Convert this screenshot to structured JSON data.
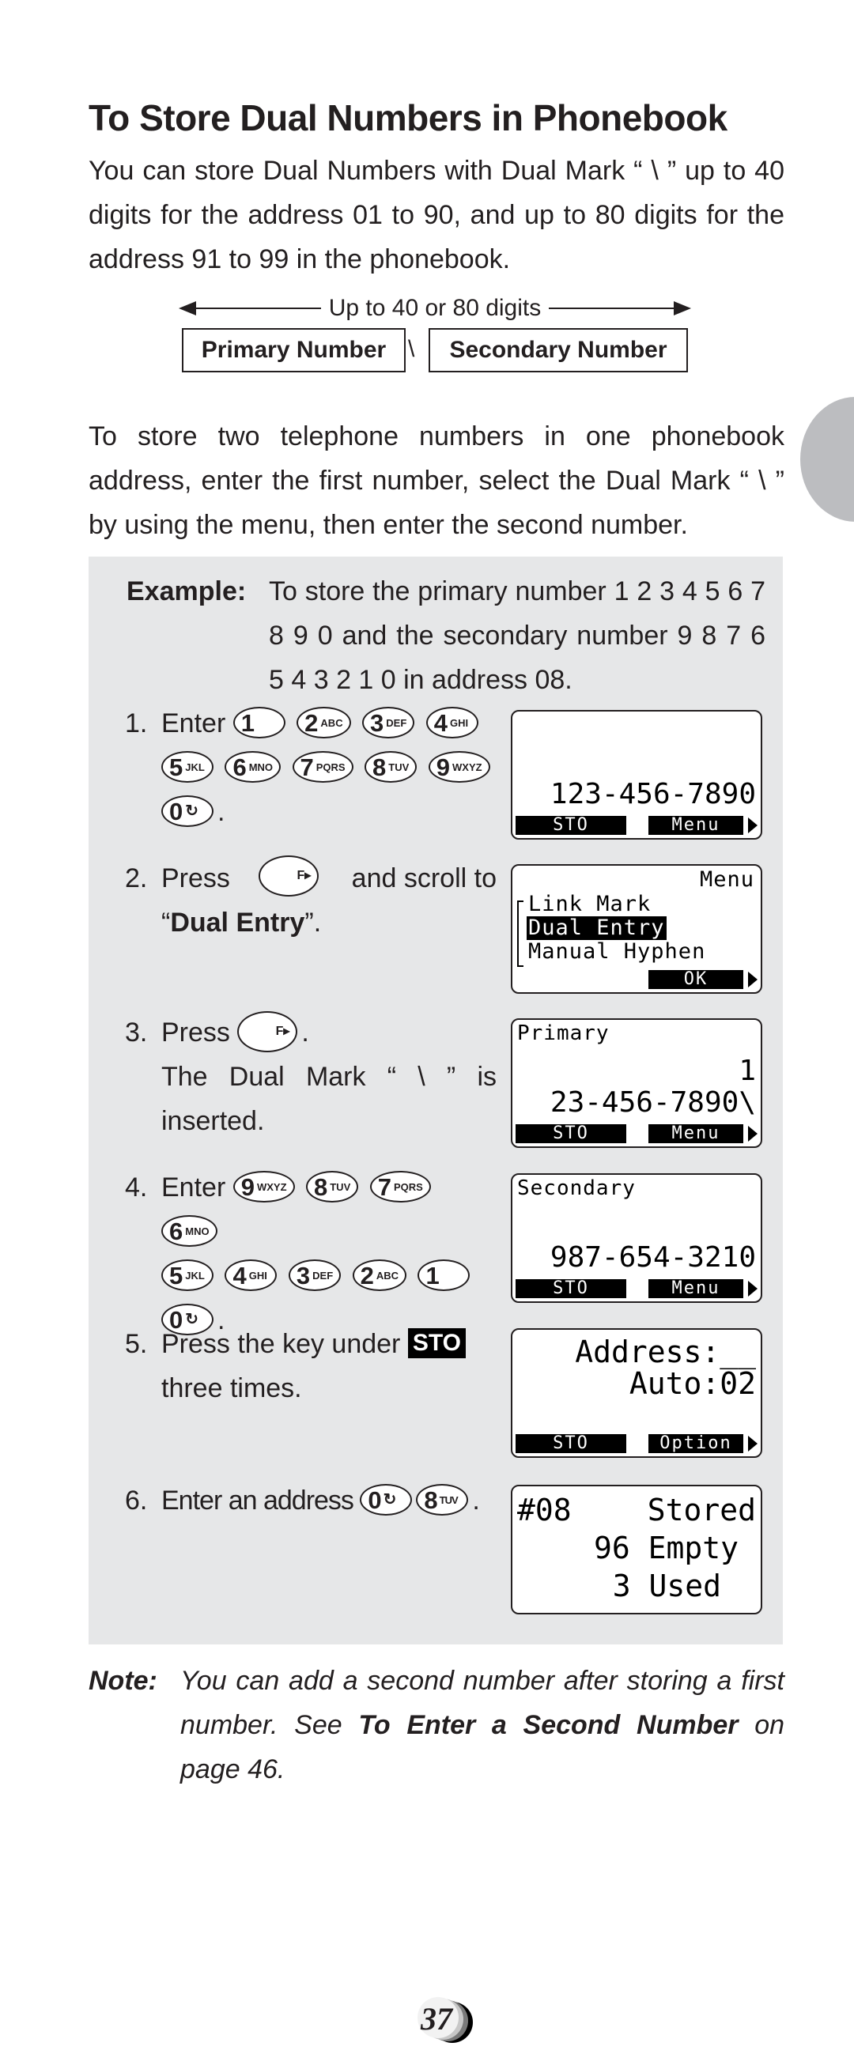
{
  "title": "To Store Dual Numbers in Phonebook",
  "intro": "You can store Dual Numbers with Dual Mark “ \\ ” up to 40 digits for the address 01 to 90, and up to 80 digits for the address 91 to 99 in the phonebook.",
  "diagram": {
    "digits_label": "Up to 40 or 80 digits",
    "primary": "Primary Number",
    "separator": "\\",
    "secondary": "Secondary Number"
  },
  "description": "To store two telephone numbers in one phonebook address, enter the first number, select the Dual Mark “ \\  ” by using the menu, then enter the second number.",
  "example": {
    "label": "Example:",
    "text": "To store the primary number 1 2 3 4 5 6 7 8 9 0 and the secondary number 9 8 7 6 5 4 3 2 1 0 in address 08."
  },
  "keys": {
    "1": {
      "digit": "1",
      "letters": ""
    },
    "2": {
      "digit": "2",
      "letters": "ABC"
    },
    "3": {
      "digit": "3",
      "letters": "DEF"
    },
    "4": {
      "digit": "4",
      "letters": "GHI"
    },
    "5": {
      "digit": "5",
      "letters": "JKL"
    },
    "6": {
      "digit": "6",
      "letters": "MNO"
    },
    "7": {
      "digit": "7",
      "letters": "PQRS"
    },
    "8": {
      "digit": "8",
      "letters": "TUV"
    },
    "9": {
      "digit": "9",
      "letters": "WXYZ"
    },
    "0": {
      "digit": "0",
      "letters": "↻"
    },
    "f": {
      "digit": "",
      "letters": "F▸"
    }
  },
  "steps": [
    {
      "num": "1.",
      "pre": "Enter",
      "post": "."
    },
    {
      "num": "2.",
      "pre": "Press",
      "mid": "and scroll to",
      "quote_open": "“",
      "bold": "Dual Entry",
      "quote_close": "”."
    },
    {
      "num": "3.",
      "pre": "Press",
      "post": ".",
      "line2": "The Dual Mark “ \\ ” is inserted."
    },
    {
      "num": "4.",
      "pre": "Enter",
      "post": "."
    },
    {
      "num": "5.",
      "pre": "Press the key under",
      "badge": "STO",
      "line2": "three times."
    },
    {
      "num": "6.",
      "pre": "Enter an address",
      "post": "."
    }
  ],
  "screens": [
    {
      "number": "123-456-7890",
      "left_key": "STO",
      "right_key": "Menu"
    },
    {
      "title": "Menu",
      "items": [
        "Link Mark",
        "Dual Entry",
        "Manual Hyphen"
      ],
      "selected": "Dual Entry",
      "right_key": "OK"
    },
    {
      "label": "Primary",
      "line1": "1",
      "line2": "23-456-7890\\",
      "left_key": "STO",
      "right_key": "Menu"
    },
    {
      "label": "Secondary",
      "number": "987-654-3210",
      "left_key": "STO",
      "right_key": "Menu"
    },
    {
      "line1": "Address:__",
      "line2": "Auto:02",
      "left_key": "STO",
      "right_key": "Option"
    },
    {
      "line1_left": "#08",
      "line1_right": "Stored",
      "line2": "96 Empty",
      "line3": "3 Used"
    }
  ],
  "note": {
    "label": "Note:",
    "text_pre": "You can add a second number after storing a first number. See ",
    "text_bold": "To Enter a Second Number",
    "text_post": " on page 46."
  },
  "page_number": "37"
}
